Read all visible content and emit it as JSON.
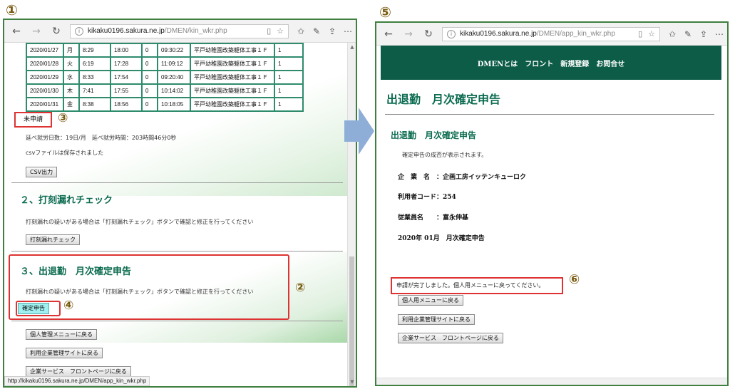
{
  "markers": {
    "m1": "①",
    "m2": "②",
    "m3": "③",
    "m4": "④",
    "m5": "⑤",
    "m6": "⑥"
  },
  "left_window": {
    "url_host": "kikaku0196.sakura.ne.jp",
    "url_path": "/DMEN/kin_wkr.php",
    "rows": [
      [
        "2020/01/27",
        "月",
        "8:29",
        "18:00",
        "0",
        "09:30:22",
        "平戸幼稚園改築躯体工事１Ｆ",
        "1"
      ],
      [
        "2020/01/28",
        "火",
        "6:19",
        "17:28",
        "0",
        "11:09:12",
        "平戸幼稚園改築躯体工事１Ｆ",
        "1"
      ],
      [
        "2020/01/29",
        "水",
        "8:33",
        "17:54",
        "0",
        "09:20:40",
        "平戸幼稚園改築躯体工事１Ｆ",
        "1"
      ],
      [
        "2020/01/30",
        "木",
        "7:41",
        "17:55",
        "0",
        "10:14:02",
        "平戸幼稚園改築躯体工事１Ｆ",
        "1"
      ],
      [
        "2020/01/31",
        "金",
        "8:38",
        "18:56",
        "0",
        "10:18:05",
        "平戸幼稚園改築躯体工事１Ｆ",
        "1"
      ]
    ],
    "status": "未申請",
    "summary": "延べ就労日数：19日/月　延べ就労時間：203時間46分0秒",
    "csv_saved": "csvファイルは保存されました",
    "csv_button": "CSV出力",
    "section2_title": "２、打刻漏れチェック",
    "section2_text": "打刻漏れの疑いがある場合は「打刻漏れチェック」ボタンで確認と修正を行ってください",
    "section2_button": "打刻漏れチェック",
    "section3_title": "３、出退勤　月次確定申告",
    "section3_text": "打刻漏れの疑いがある場合は「打刻漏れチェック」ボタンで確認と修正を行ってください",
    "confirm_button": "確定申告",
    "back_personal": "個人管理メニューに戻る",
    "back_company": "利用企業管理サイトに戻る",
    "back_front": "企業サービス　フロントページに戻る",
    "status_url": "http://kikaku0196.sakura.ne.jp/DMEN/app_kin_wkr.php"
  },
  "right_window": {
    "url_host": "kikaku0196.sakura.ne.jp",
    "url_path": "/DMEN/app_kin_wkr.php",
    "nav": [
      "DMENとは",
      "フロント",
      "新規登録",
      "お問合せ"
    ],
    "title": "出退勤　月次確定申告",
    "subtitle": "出退勤　月次確定申告",
    "info": "確定申告の成否が表示されます。",
    "company": "企　業　名　：企画工房イッテンキューロク",
    "user_code": "利用者コード：254",
    "employee": "従業員名　　：富永伸基",
    "period": "2020年 01月　月次確定申告",
    "message": "申請が完了しました。個人用メニューに戻ってください。",
    "btn_personal": "個人用メニューに戻る",
    "btn_company": "利用企業管理サイトに戻る",
    "btn_front": "企業サービス　フロントページに戻る"
  },
  "colors": {
    "accent": "#0b6b4f",
    "highlight": "#d33333",
    "arrow": "#8eaed8"
  }
}
